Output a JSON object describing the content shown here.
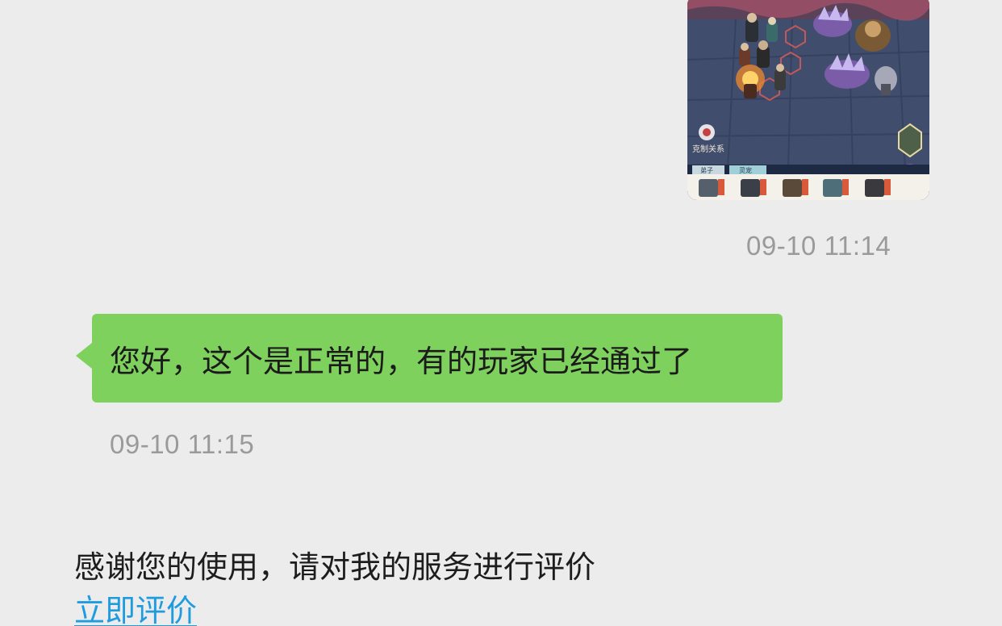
{
  "messages": [
    {
      "type": "image",
      "direction": "outgoing",
      "image": {
        "description_icon": "game-screenshot-image",
        "labels": {
          "bottom_left": "克制关系",
          "tab_1": "弟子",
          "tab_2": "灵宠"
        }
      },
      "timestamp": "09-10 11:14"
    },
    {
      "type": "text",
      "direction": "incoming",
      "text": "您好，这个是正常的，有的玩家已经通过了",
      "timestamp": "09-10 11:15"
    },
    {
      "type": "system",
      "text": "感谢您的使用，请对我的服务进行评价",
      "link": "立即评价"
    }
  ],
  "colors": {
    "background": "#ececec",
    "bubble": "#7fd15e",
    "timestamp": "#9a9a9a",
    "link": "#1f9be0"
  }
}
